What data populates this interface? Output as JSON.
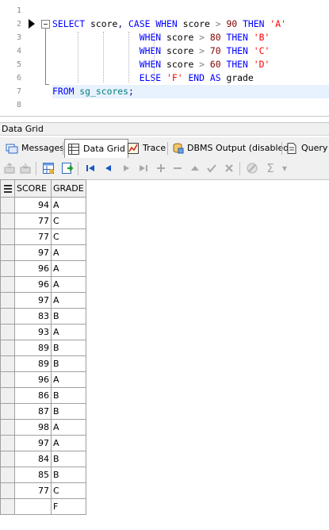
{
  "editor": {
    "line_numbers": [
      "1",
      "2",
      "3",
      "4",
      "5",
      "6",
      "7",
      "8"
    ],
    "lines": [
      {
        "text": ""
      },
      {
        "tokens": [
          {
            "t": "SELECT",
            "c": "kw"
          },
          {
            "t": " score",
            "c": "id"
          },
          {
            "t": ",",
            "c": "punc"
          },
          {
            "t": " CASE",
            "c": "kw"
          },
          {
            "t": " WHEN",
            "c": "kw"
          },
          {
            "t": " score",
            "c": "id"
          },
          {
            "t": " >",
            "c": "op"
          },
          {
            "t": " 90",
            "c": "num"
          },
          {
            "t": " THEN",
            "c": "kw"
          },
          {
            "t": " 'A'",
            "c": "str"
          }
        ]
      },
      {
        "tokens": [
          {
            "t": "                WHEN",
            "c": "kw"
          },
          {
            "t": " score",
            "c": "id"
          },
          {
            "t": " >",
            "c": "op"
          },
          {
            "t": " 80",
            "c": "num"
          },
          {
            "t": " THEN",
            "c": "kw"
          },
          {
            "t": " 'B'",
            "c": "str"
          }
        ]
      },
      {
        "tokens": [
          {
            "t": "                WHEN",
            "c": "kw"
          },
          {
            "t": " score",
            "c": "id"
          },
          {
            "t": " >",
            "c": "op"
          },
          {
            "t": " 70",
            "c": "num"
          },
          {
            "t": " THEN",
            "c": "kw"
          },
          {
            "t": " 'C'",
            "c": "str"
          }
        ]
      },
      {
        "tokens": [
          {
            "t": "                WHEN",
            "c": "kw"
          },
          {
            "t": " score",
            "c": "id"
          },
          {
            "t": " >",
            "c": "op"
          },
          {
            "t": " 60",
            "c": "num"
          },
          {
            "t": " THEN",
            "c": "kw"
          },
          {
            "t": " 'D'",
            "c": "str"
          }
        ]
      },
      {
        "tokens": [
          {
            "t": "                ELSE",
            "c": "kw"
          },
          {
            "t": " 'F'",
            "c": "str"
          },
          {
            "t": " END",
            "c": "kw"
          },
          {
            "t": " AS",
            "c": "kw"
          },
          {
            "t": " grade",
            "c": "id"
          }
        ]
      },
      {
        "tokens": [
          {
            "t": "FROM",
            "c": "kw"
          },
          {
            "t": " sg_scores",
            "c": "tbl"
          },
          {
            "t": ";",
            "c": "punc"
          }
        ]
      },
      {
        "text": ""
      }
    ]
  },
  "panel": {
    "title": "Data Grid"
  },
  "tabs": [
    {
      "label": "Messages",
      "icon": "messages-icon"
    },
    {
      "label": "Data Grid",
      "icon": "grid-icon",
      "active": true
    },
    {
      "label": "Trace",
      "icon": "trace-icon"
    },
    {
      "label": "DBMS Output (disabled)",
      "icon": "dbms-output-icon"
    },
    {
      "label": "Query",
      "icon": "query-icon"
    }
  ],
  "toolbar": {
    "icons": [
      "export-icon",
      "import-icon",
      "grid-view-icon",
      "refresh-icon",
      "first-record-icon",
      "prior-record-icon",
      "next-record-icon",
      "last-record-icon",
      "insert-record-icon",
      "delete-record-icon",
      "edit-record-icon",
      "post-edit-icon",
      "cancel-edit-icon",
      "filter-icon",
      "sum-icon",
      "dropdown-icon"
    ]
  },
  "grid": {
    "columns": [
      "SCORE",
      "GRADE"
    ],
    "rows": [
      [
        "94",
        "A"
      ],
      [
        "77",
        "C"
      ],
      [
        "77",
        "C"
      ],
      [
        "97",
        "A"
      ],
      [
        "96",
        "A"
      ],
      [
        "96",
        "A"
      ],
      [
        "97",
        "A"
      ],
      [
        "83",
        "B"
      ],
      [
        "93",
        "A"
      ],
      [
        "89",
        "B"
      ],
      [
        "89",
        "B"
      ],
      [
        "96",
        "A"
      ],
      [
        "86",
        "B"
      ],
      [
        "87",
        "B"
      ],
      [
        "98",
        "A"
      ],
      [
        "97",
        "A"
      ],
      [
        "84",
        "B"
      ],
      [
        "85",
        "B"
      ],
      [
        "77",
        "C"
      ],
      [
        "",
        "F"
      ]
    ]
  }
}
